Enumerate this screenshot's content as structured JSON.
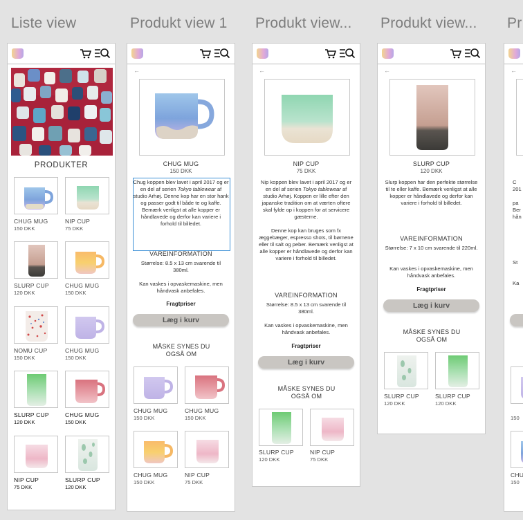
{
  "frames": [
    {
      "title": "Liste view"
    },
    {
      "title": "Produkt view 1"
    },
    {
      "title": "Produkt view..."
    },
    {
      "title": "Produkt view..."
    },
    {
      "title": "Pr"
    }
  ],
  "icons": {
    "cart": "cart-icon",
    "menu_search": "menu-search-icon",
    "back": "back-arrow-icon",
    "logo": "mug-logo"
  },
  "list": {
    "heading": "PRODUKTER",
    "items": [
      {
        "name": "CHUG MUG",
        "price": "150 DKK"
      },
      {
        "name": "NIP CUP",
        "price": "75 DKK"
      },
      {
        "name": "SLURP CUP",
        "price": "120 DKK"
      },
      {
        "name": "CHUG MUG",
        "price": "150 DKK"
      },
      {
        "name": "NOMU CUP",
        "price": "150 DKK"
      },
      {
        "name": "CHUG MUG",
        "price": "150 DKK"
      },
      {
        "name": "SLURP CUP",
        "price": "120 DKK"
      },
      {
        "name": "CHUG MUG",
        "price": "150 DKK"
      },
      {
        "name": "NIP CUP",
        "price": "75 DKK"
      },
      {
        "name": "SLURP CUP",
        "price": "120 DKK"
      }
    ]
  },
  "p1": {
    "title": "CHUG MUG",
    "price": "150 DKK",
    "desc1": "Chug koppen blev lavet i april 2017 og er en del af serien",
    "desc1_em": "Tokyo tablewear",
    "desc1_end": "af studio Arhøj.",
    "desc2": "Denne kop har en stor hank og passer godt til både te og kaffe. Bemærk venligst at alle kopper er håndlavede og derfor kan variere i forhold til billedet.",
    "vare_title": "VAREINFORMATION",
    "size": "Størrelse: 8.5 x 13 cm svarende til 380ml.",
    "wash": "Kan vaskes i opvaskemaskine, men håndvask anbefales.",
    "freight": "Fragtpriser",
    "button": "Læg i kurv",
    "maybe": "MÅSKE SYNES DU OGSÅ OM",
    "related": [
      {
        "name": "CHUG MUG",
        "price": "150 DKK"
      },
      {
        "name": "CHUG MUG",
        "price": "150 DKK"
      },
      {
        "name": "CHUG MUG",
        "price": "150 DKK"
      },
      {
        "name": "NIP CUP",
        "price": "75 DKK"
      }
    ]
  },
  "p2": {
    "title": "NIP CUP",
    "price": "75 DKK",
    "desc1": "Nip koppen blev lavet i april 2017 og er en del af serien",
    "desc1_em": "Tokyo tablewear",
    "desc1_end": "af studio Arhøj. Koppen er lille efter den japanske tradition om at værten oftere skal fylde op i koppen for at servicere gæsterne.",
    "desc2": "Denne kop kan bruges som fx æggebæger, espresso shots, til børnene eller til salt og peber. Bemærk venligst at alle kopper er håndlavede og derfor kan variere i forhold til billedet.",
    "vare_title": "VAREINFORMATION",
    "size": "Størrelse: 8.5 x 13 cm svarende til 380ml.",
    "wash": "Kan vaskes i opvaskemaskine, men håndvask anbefales.",
    "freight": "Fragtpriser",
    "button": "Læg i kurv",
    "maybe": "MÅSKE SYNES DU OGSÅ OM",
    "related": [
      {
        "name": "SLURP CUP",
        "price": "120 DKK"
      },
      {
        "name": "NIP CUP",
        "price": "75 DKK"
      }
    ]
  },
  "p3": {
    "title": "SLURP CUP",
    "price": "120 DKK",
    "desc1": "Slurp koppen har den perfekte størrelse til te eller kaffe. Bemærk venligst at alle kopper er håndlavede og derfor kan variere i forhold til billedet.",
    "vare_title": "VAREINFORMATION",
    "size": "Størrelse: 7 x 10 cm svarende til 220ml.",
    "wash": "Kan vaskes i opvaskemaskine, men håndvask anbefales.",
    "freight": "Fragtpriser",
    "button": "Læg i kurv",
    "maybe": "MÅSKE SYNES DU OGSÅ OM",
    "related": [
      {
        "name": "SLURP CUP",
        "price": "120 DKK"
      },
      {
        "name": "SLURP CUP",
        "price": "120 DKK"
      }
    ]
  },
  "p4": {
    "partial_lines": [
      "C",
      "201",
      "",
      "pa",
      "Ber",
      "hån",
      "",
      "St",
      "",
      "Ka"
    ],
    "related": [
      {
        "name": "",
        "price": "150"
      },
      {
        "name": "CHU",
        "price": "150"
      }
    ]
  }
}
